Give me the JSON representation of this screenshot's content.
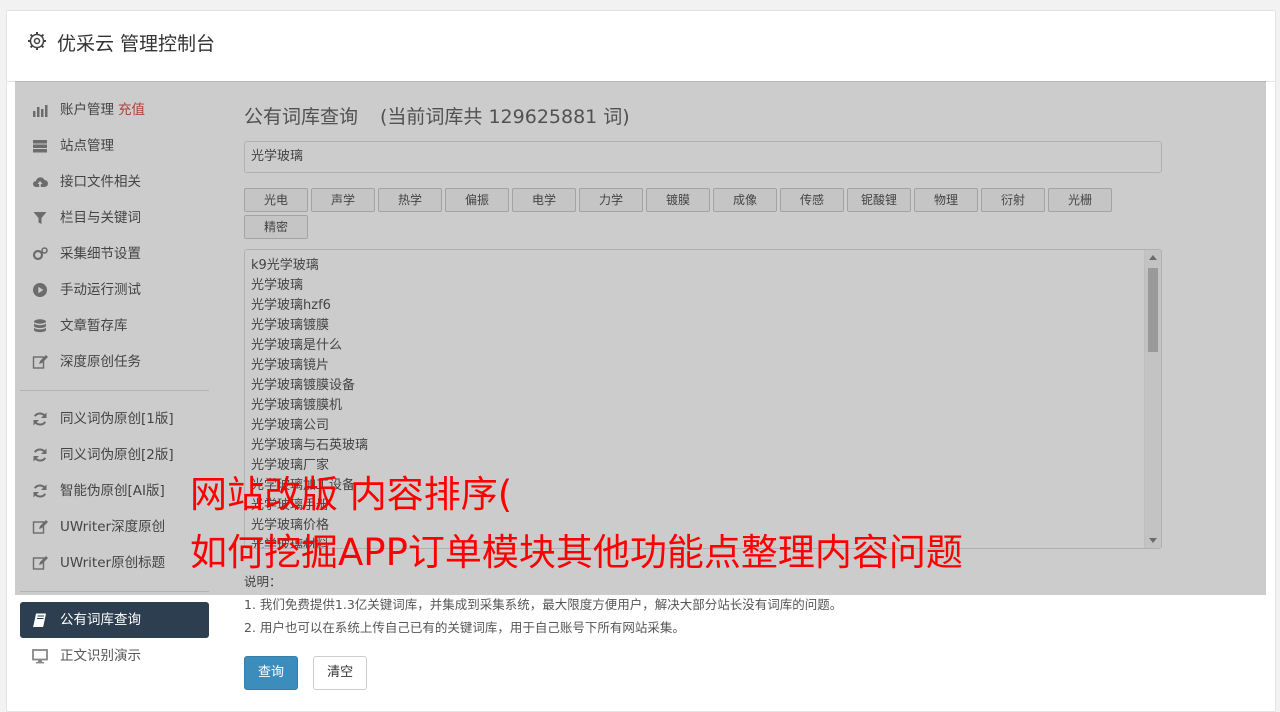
{
  "header": {
    "title": "优采云 管理控制台"
  },
  "sidebar": {
    "group1": [
      {
        "label": "账户管理",
        "badge": "充值",
        "icon": "bar-chart-icon"
      },
      {
        "label": "站点管理",
        "icon": "server-icon"
      },
      {
        "label": "接口文件相关",
        "icon": "cloud-upload-icon"
      },
      {
        "label": "栏目与关键词",
        "icon": "filter-icon"
      },
      {
        "label": "采集细节设置",
        "icon": "gears-icon"
      },
      {
        "label": "手动运行测试",
        "icon": "play-circle-icon"
      },
      {
        "label": "文章暂存库",
        "icon": "database-icon"
      },
      {
        "label": "深度原创任务",
        "icon": "edit-icon"
      }
    ],
    "group2": [
      {
        "label": "同义词伪原创[1版]",
        "icon": "refresh-icon"
      },
      {
        "label": "同义词伪原创[2版]",
        "icon": "refresh-icon"
      },
      {
        "label": "智能伪原创[AI版]",
        "icon": "refresh-icon"
      },
      {
        "label": "UWriter深度原创",
        "icon": "edit-icon"
      },
      {
        "label": "UWriter原创标题",
        "icon": "edit-icon"
      }
    ],
    "group3": [
      {
        "label": "公有词库查询",
        "icon": "book-icon",
        "active": true
      },
      {
        "label": "正文识别演示",
        "icon": "monitor-icon"
      }
    ]
  },
  "main": {
    "heading": "公有词库查询",
    "count_text": "(当前词库共 129625881 词)",
    "search_value": "光学玻璃",
    "tags": [
      "光电",
      "声学",
      "热学",
      "偏振",
      "电学",
      "力学",
      "镀膜",
      "成像",
      "传感",
      "铌酸锂",
      "物理",
      "衍射",
      "光栅",
      "精密"
    ],
    "results": [
      "k9光学玻璃",
      "光学玻璃",
      "光学玻璃hzf6",
      "光学玻璃镀膜",
      "光学玻璃是什么",
      "光学玻璃镜片",
      "光学玻璃镀膜设备",
      "光学玻璃镀膜机",
      "光学玻璃公司",
      "光学玻璃与石英玻璃",
      "光学玻璃厂家",
      "光学玻璃加工设备",
      "光学玻璃手册",
      "光学玻璃价格",
      "光学玻璃材料"
    ],
    "notes_title": "说明：",
    "notes": [
      "1. 我们免费提供1.3亿关键词库，并集成到采集系统，最大限度方便用户，解决大部分站长没有词库的问题。",
      "2. 用户也可以在系统上传自己已有的关键词库，用于自己账号下所有网站采集。"
    ],
    "query_button": "查询",
    "clear_button": "清空"
  },
  "overlay": {
    "line1": "网站改版 内容排序(",
    "line2": "如何挖掘APP订单模块其他功能点整理内容问题"
  }
}
